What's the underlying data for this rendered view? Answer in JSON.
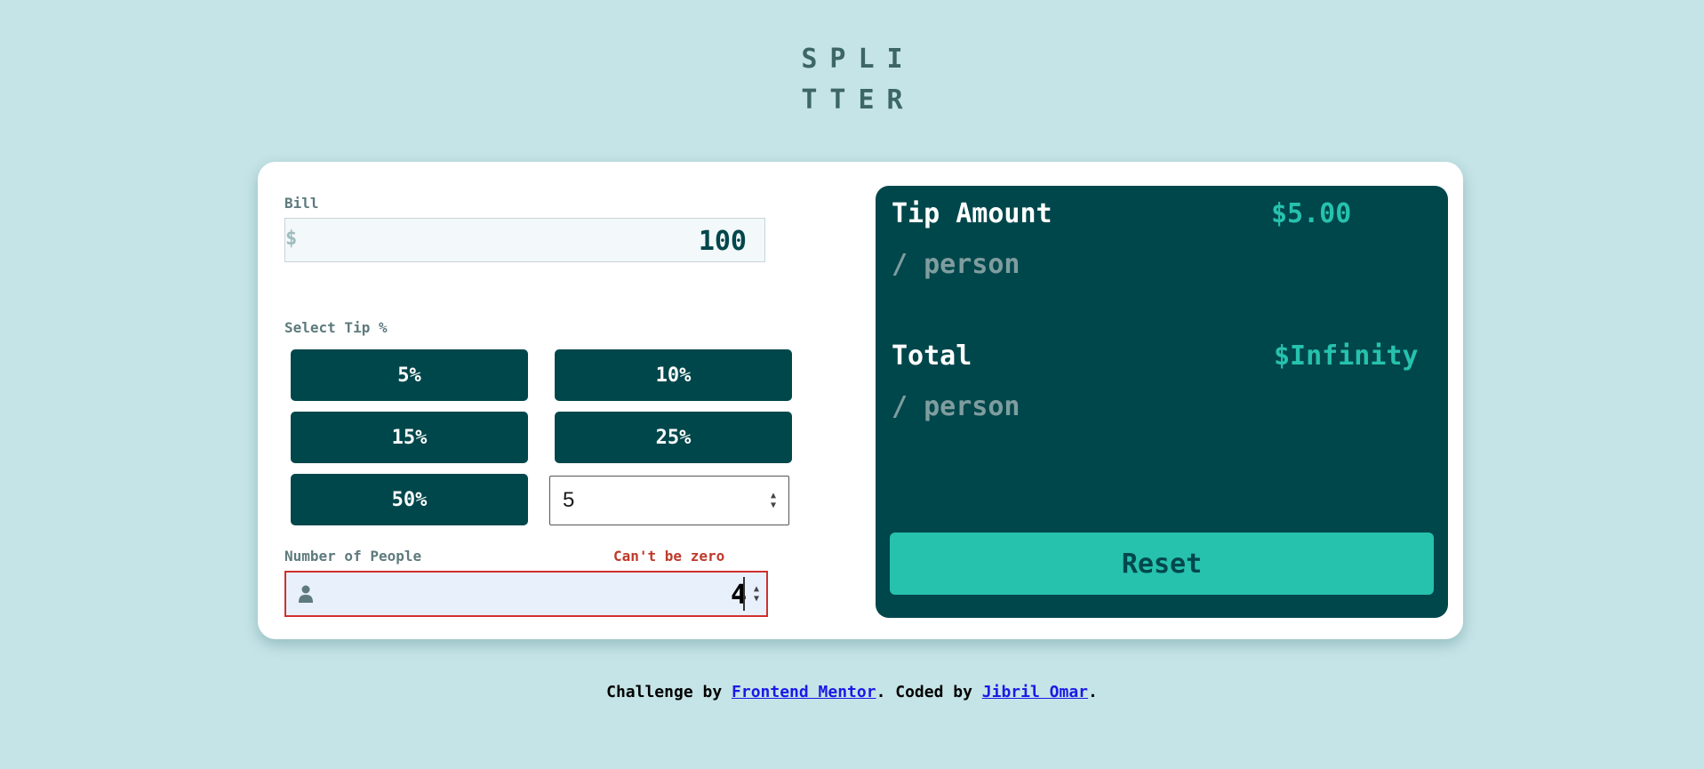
{
  "logo": {
    "line1": "SPLI",
    "line2": "TTER"
  },
  "bill": {
    "label": "Bill",
    "currency_symbol": "$",
    "value": "100"
  },
  "tip": {
    "label": "Select Tip %",
    "options": [
      "5%",
      "10%",
      "15%",
      "25%",
      "50%"
    ],
    "custom_value": "5"
  },
  "people": {
    "label": "Number of People",
    "error": "Can't be zero",
    "value": "4",
    "icon": "person-icon"
  },
  "results": {
    "tip_amount": {
      "title": "Tip Amount",
      "sub": "/ person",
      "value": "$5.00"
    },
    "total": {
      "title": "Total",
      "sub": "/ person",
      "value": "$Infinity"
    },
    "reset_label": "Reset"
  },
  "footer": {
    "prefix": "Challenge by ",
    "link1": "Frontend Mentor",
    "middle": ". Coded by ",
    "link2": "Jibril Omar",
    "suffix": "."
  },
  "colors": {
    "background": "#c5e4e7",
    "primary": "#00474b",
    "accent": "#26c2ae",
    "error": "#d0302f"
  }
}
